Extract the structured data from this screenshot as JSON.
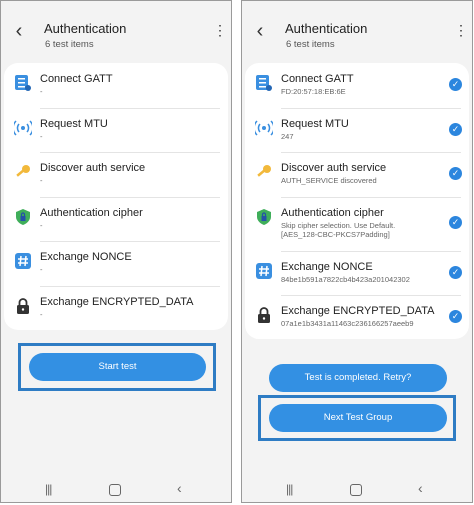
{
  "status_bar": {
    "time": "",
    "icons": ""
  },
  "left": {
    "title": "Authentication",
    "subtitle": "6 test items",
    "items": [
      {
        "name": "Connect GATT",
        "sub": "-",
        "icon": "checklist-icon"
      },
      {
        "name": "Request MTU",
        "sub": "-",
        "icon": "signal-icon"
      },
      {
        "name": "Discover auth service",
        "sub": "-",
        "icon": "key-icon"
      },
      {
        "name": "Authentication cipher",
        "sub": "-",
        "icon": "shield-icon"
      },
      {
        "name": "Exchange NONCE",
        "sub": "-",
        "icon": "hash-icon"
      },
      {
        "name": "Exchange ENCRYPTED_DATA",
        "sub": "-",
        "icon": "lock-icon"
      }
    ],
    "start_button": "Start test"
  },
  "right": {
    "title": "Authentication",
    "subtitle": "6 test items",
    "items": [
      {
        "name": "Connect GATT",
        "sub": "FD:20:57:18:EB:6E",
        "icon": "checklist-icon"
      },
      {
        "name": "Request MTU",
        "sub": "247",
        "icon": "signal-icon"
      },
      {
        "name": "Discover auth service",
        "sub": "AUTH_SERVICE discovered",
        "icon": "key-icon"
      },
      {
        "name": "Authentication cipher",
        "sub": "Skip cipher selection. Use Default.\n[AES_128-CBC-PKCS7Padding]",
        "icon": "shield-icon"
      },
      {
        "name": "Exchange NONCE",
        "sub": "84be1b591a7822cb4b423a201042302",
        "icon": "hash-icon"
      },
      {
        "name": "Exchange ENCRYPTED_DATA",
        "sub": "07a1e1b3431a11463c236166257aeeb9",
        "icon": "lock-icon"
      }
    ],
    "retry_button": "Test is completed. Retry?",
    "next_button": "Next Test Group"
  },
  "colors": {
    "accent": "#3390e3",
    "highlight_frame": "#2e7cc4",
    "check": "#2c86de"
  }
}
